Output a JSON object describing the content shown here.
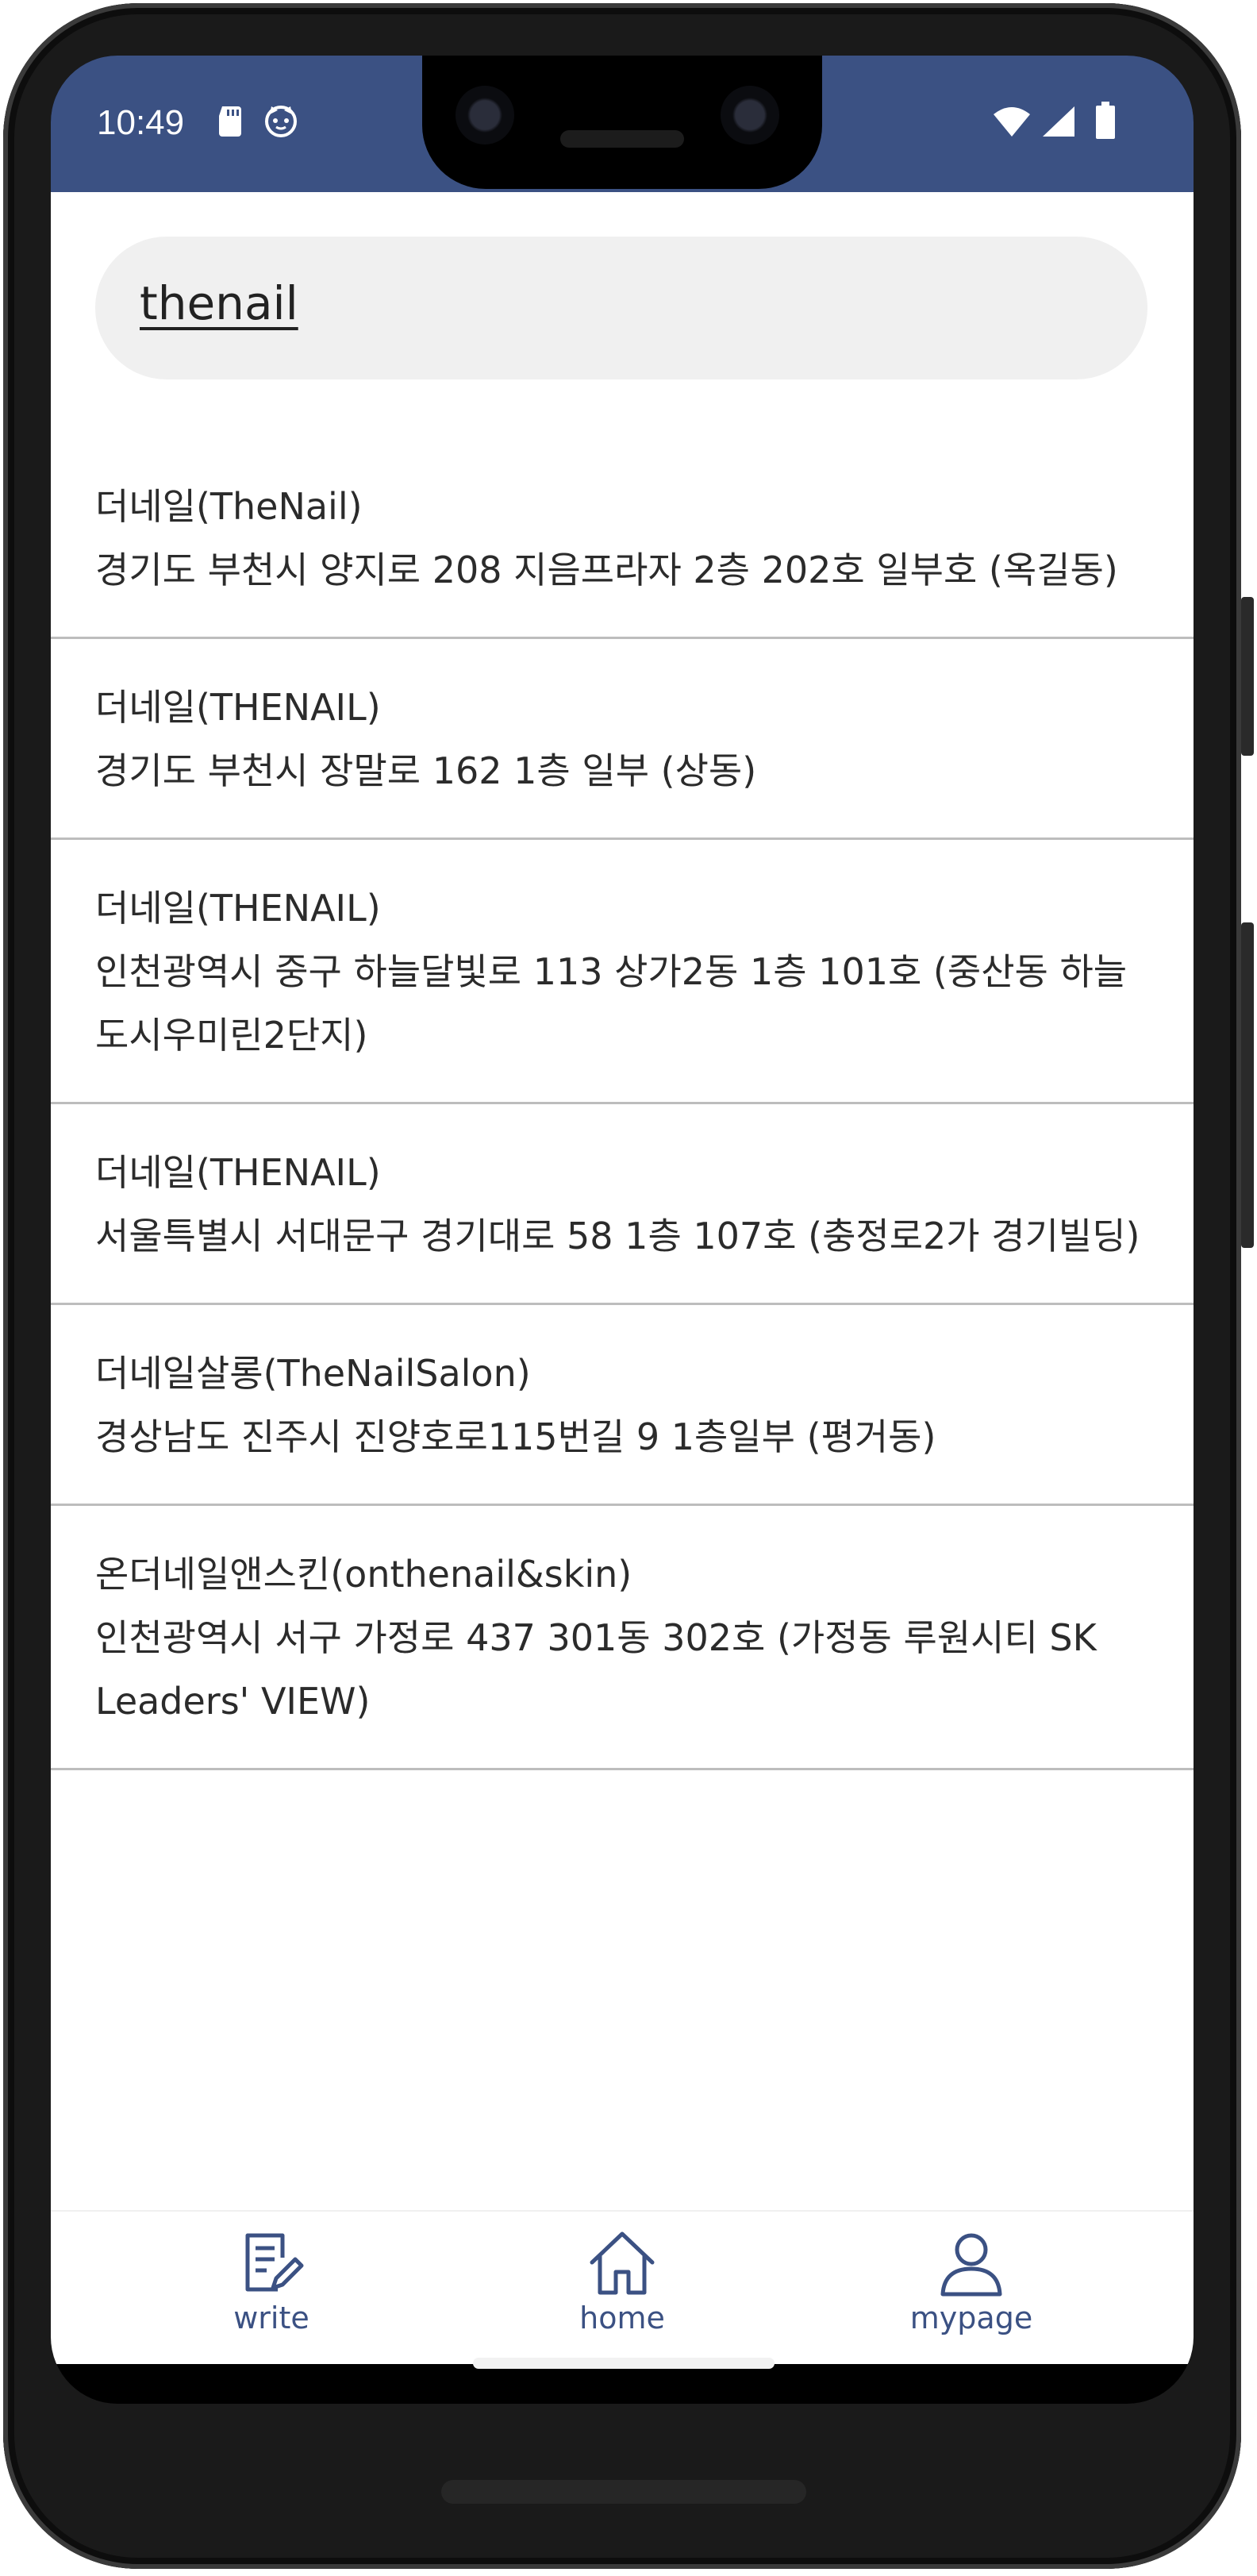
{
  "status_bar": {
    "time": "10:49",
    "left_icons": [
      "sd-card-icon",
      "cat-face-icon"
    ],
    "right_icons": [
      "wifi-icon",
      "cell-signal-icon",
      "battery-icon"
    ],
    "background": "#3b5183"
  },
  "search": {
    "value": "thenail",
    "placeholder": ""
  },
  "results": [
    {
      "name": "더네일(TheNail)",
      "address": "경기도 부천시 양지로 208  지음프라자 2층 202호 일부호 (옥길동)"
    },
    {
      "name": "더네일(THENAIL)",
      "address": "경기도 부천시 장말로 162  1층 일부 (상동)"
    },
    {
      "name": "더네일(THENAIL)",
      "address": "인천광역시 중구 하늘달빛로 113  상가2동 1층 101호 (중산동  하늘도시우미린2단지)"
    },
    {
      "name": "더네일(THENAIL)",
      "address": "서울특별시 서대문구 경기대로 58  1층 107호 (충정로2가 경기빌딩)"
    },
    {
      "name": "더네일살롱(TheNailSalon)",
      "address": "경상남도 진주시 진양호로115번길 9  1층일부 (평거동)"
    },
    {
      "name": "온더네일앤스킨(onthenail&skin)",
      "address": "인천광역시 서구 가정로 437  301동 302호 (가정동  루원시티 SK Leaders' VIEW)"
    }
  ],
  "bottom_nav": {
    "tabs": [
      {
        "label": "write",
        "icon": "edit-document-icon"
      },
      {
        "label": "home",
        "icon": "home-icon"
      },
      {
        "label": "mypage",
        "icon": "person-icon"
      }
    ],
    "accent": "#3b5183"
  }
}
